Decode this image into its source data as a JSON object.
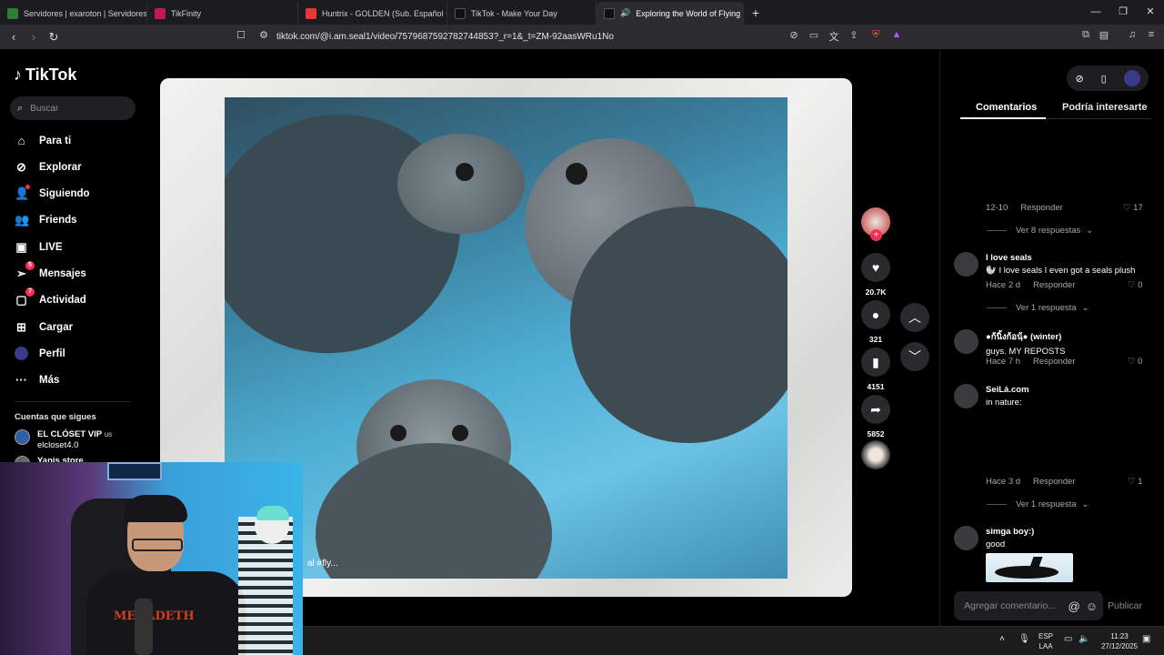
{
  "browser": {
    "tabs": [
      {
        "title": "Servidores | exaroton | Servidores de",
        "color": "#2e7d32"
      },
      {
        "title": "TikFinity",
        "color": "#c2185b"
      },
      {
        "title": "Huntrix - GOLDEN (Sub. Español + Ly",
        "color": "#e53935"
      },
      {
        "title": "TikTok - Make Your Day",
        "color": "#111111"
      },
      {
        "title": "Exploring the World of Flying",
        "color": "#111111",
        "active": true
      }
    ],
    "new_tab": "+",
    "url": "tiktok.com/@i.am.seal1/video/7579687592782744853?_r=1&_t=ZM-92aasWRu1No"
  },
  "sidebar": {
    "brand": "TikTok",
    "search_placeholder": "Buscar",
    "nav": [
      {
        "label": "Para ti",
        "icon": "home-icon"
      },
      {
        "label": "Explorar",
        "icon": "compass-icon"
      },
      {
        "label": "Siguiendo",
        "icon": "following-icon"
      },
      {
        "label": "Friends",
        "icon": "friends-icon"
      },
      {
        "label": "LIVE",
        "icon": "live-icon"
      },
      {
        "label": "Mensajes",
        "icon": "messages-icon",
        "badge": "5"
      },
      {
        "label": "Actividad",
        "icon": "activity-icon",
        "badge": "7"
      },
      {
        "label": "Cargar",
        "icon": "upload-icon"
      },
      {
        "label": "Perfil",
        "icon": "profile-icon"
      },
      {
        "label": "Más",
        "icon": "more-icon"
      }
    ],
    "following_title": "Cuentas que sigues",
    "accounts": [
      {
        "name": "EL CLÓSET VIP",
        "suffix": "us",
        "handle": "elcloset4.0"
      },
      {
        "name": "Yanis store",
        "handle": ""
      }
    ]
  },
  "video": {
    "caption_fragment": "al #fly..."
  },
  "actions": {
    "likes": "20.7K",
    "comments": "321",
    "saves": "4151",
    "shares": "5852"
  },
  "panel": {
    "tabs": [
      "Comentarios",
      "Podría interesarte"
    ],
    "first_meta": {
      "date": "12-10",
      "reply": "Responder",
      "likes": "17"
    },
    "first_replies": "Ver 8 respuestas",
    "comments": [
      {
        "name": "I love seals",
        "text": "I love seals I even got a seals plush",
        "emoji": "🦭",
        "date": "Hace 2 d",
        "reply": "Responder",
        "likes": "0",
        "replies": "Ver 1 respuesta"
      },
      {
        "name": "●ก้นิ้งก้อนฺ้● (winter)",
        "text": "guys. MY REPOSTS",
        "date": "Hace 7 h",
        "reply": "Responder",
        "likes": "0"
      },
      {
        "name": "SeiLá.com",
        "text": "in nature:",
        "date": "Hace 3 d",
        "reply": "Responder",
        "likes": "1",
        "replies": "Ver 1 respuesta"
      },
      {
        "name": "simga boy:)",
        "text": "good"
      }
    ],
    "comment_placeholder": "Agregar comentario...",
    "publish": "Publicar"
  },
  "taskbar": {
    "lang_top": "ESP",
    "lang_bottom": "LAA",
    "time": "11:23",
    "date": "27/12/2025"
  },
  "webcam": {
    "shirt_text": "MEGADETH"
  }
}
